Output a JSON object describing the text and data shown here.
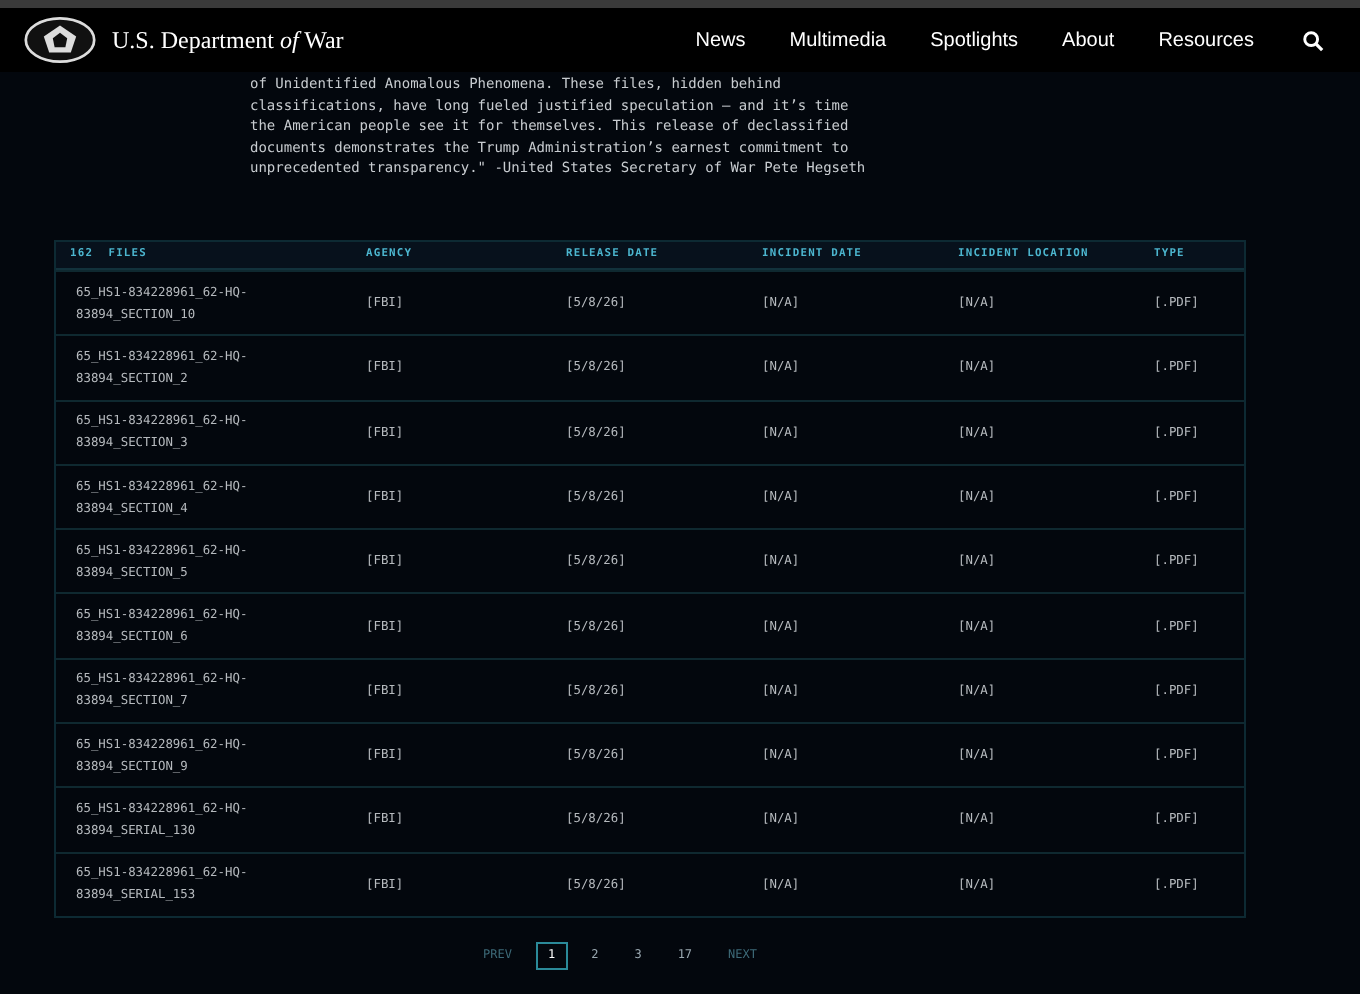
{
  "header": {
    "brand": "U.S. Department",
    "brand_italic": "of",
    "brand_end": "War",
    "nav": [
      {
        "label": "News"
      },
      {
        "label": "Multimedia"
      },
      {
        "label": "Spotlights"
      },
      {
        "label": "About"
      },
      {
        "label": "Resources"
      }
    ]
  },
  "intro": [
    "of Unidentified Anomalous Phenomena. These files, hidden behind",
    "classifications, have long fueled justified speculation – and it’s time",
    "the American people see it for themselves. This release of declassified",
    "documents demonstrates the Trump Administration’s earnest commitment to",
    "unprecedented transparency.\" -United States Secretary of War Pete Hegseth"
  ],
  "table": {
    "columns": [
      "162  FILES",
      "AGENCY",
      "RELEASE DATE",
      "INCIDENT DATE",
      "INCIDENT LOCATION",
      "TYPE"
    ],
    "rows": [
      [
        "65_HS1-834228961_62-HQ-83894_SECTION_10",
        "[FBI]",
        "[5/8/26]",
        "[N/A]",
        "[N/A]",
        "[.PDF]"
      ],
      [
        "65_HS1-834228961_62-HQ-83894_SECTION_2",
        "[FBI]",
        "[5/8/26]",
        "[N/A]",
        "[N/A]",
        "[.PDF]"
      ],
      [
        "65_HS1-834228961_62-HQ-83894_SECTION_3",
        "[FBI]",
        "[5/8/26]",
        "[N/A]",
        "[N/A]",
        "[.PDF]"
      ],
      [
        "65_HS1-834228961_62-HQ-83894_SECTION_4",
        "[FBI]",
        "[5/8/26]",
        "[N/A]",
        "[N/A]",
        "[.PDF]"
      ],
      [
        "65_HS1-834228961_62-HQ-83894_SECTION_5",
        "[FBI]",
        "[5/8/26]",
        "[N/A]",
        "[N/A]",
        "[.PDF]"
      ],
      [
        "65_HS1-834228961_62-HQ-83894_SECTION_6",
        "[FBI]",
        "[5/8/26]",
        "[N/A]",
        "[N/A]",
        "[.PDF]"
      ],
      [
        "65_HS1-834228961_62-HQ-83894_SECTION_7",
        "[FBI]",
        "[5/8/26]",
        "[N/A]",
        "[N/A]",
        "[.PDF]"
      ],
      [
        "65_HS1-834228961_62-HQ-83894_SECTION_9",
        "[FBI]",
        "[5/8/26]",
        "[N/A]",
        "[N/A]",
        "[.PDF]"
      ],
      [
        "65_HS1-834228961_62-HQ-83894_SERIAL_130",
        "[FBI]",
        "[5/8/26]",
        "[N/A]",
        "[N/A]",
        "[.PDF]"
      ],
      [
        "65_HS1-834228961_62-HQ-83894_SERIAL_153",
        "[FBI]",
        "[5/8/26]",
        "[N/A]",
        "[N/A]",
        "[.PDF]"
      ]
    ]
  },
  "pagination": [
    {
      "label": "PREV",
      "selected": false
    },
    {
      "label": "1",
      "selected": true
    },
    {
      "label": "2",
      "selected": false
    },
    {
      "label": "3",
      "selected": false
    },
    {
      "label": "17",
      "selected": false
    },
    {
      "label": "NEXT",
      "selected": false
    }
  ]
}
